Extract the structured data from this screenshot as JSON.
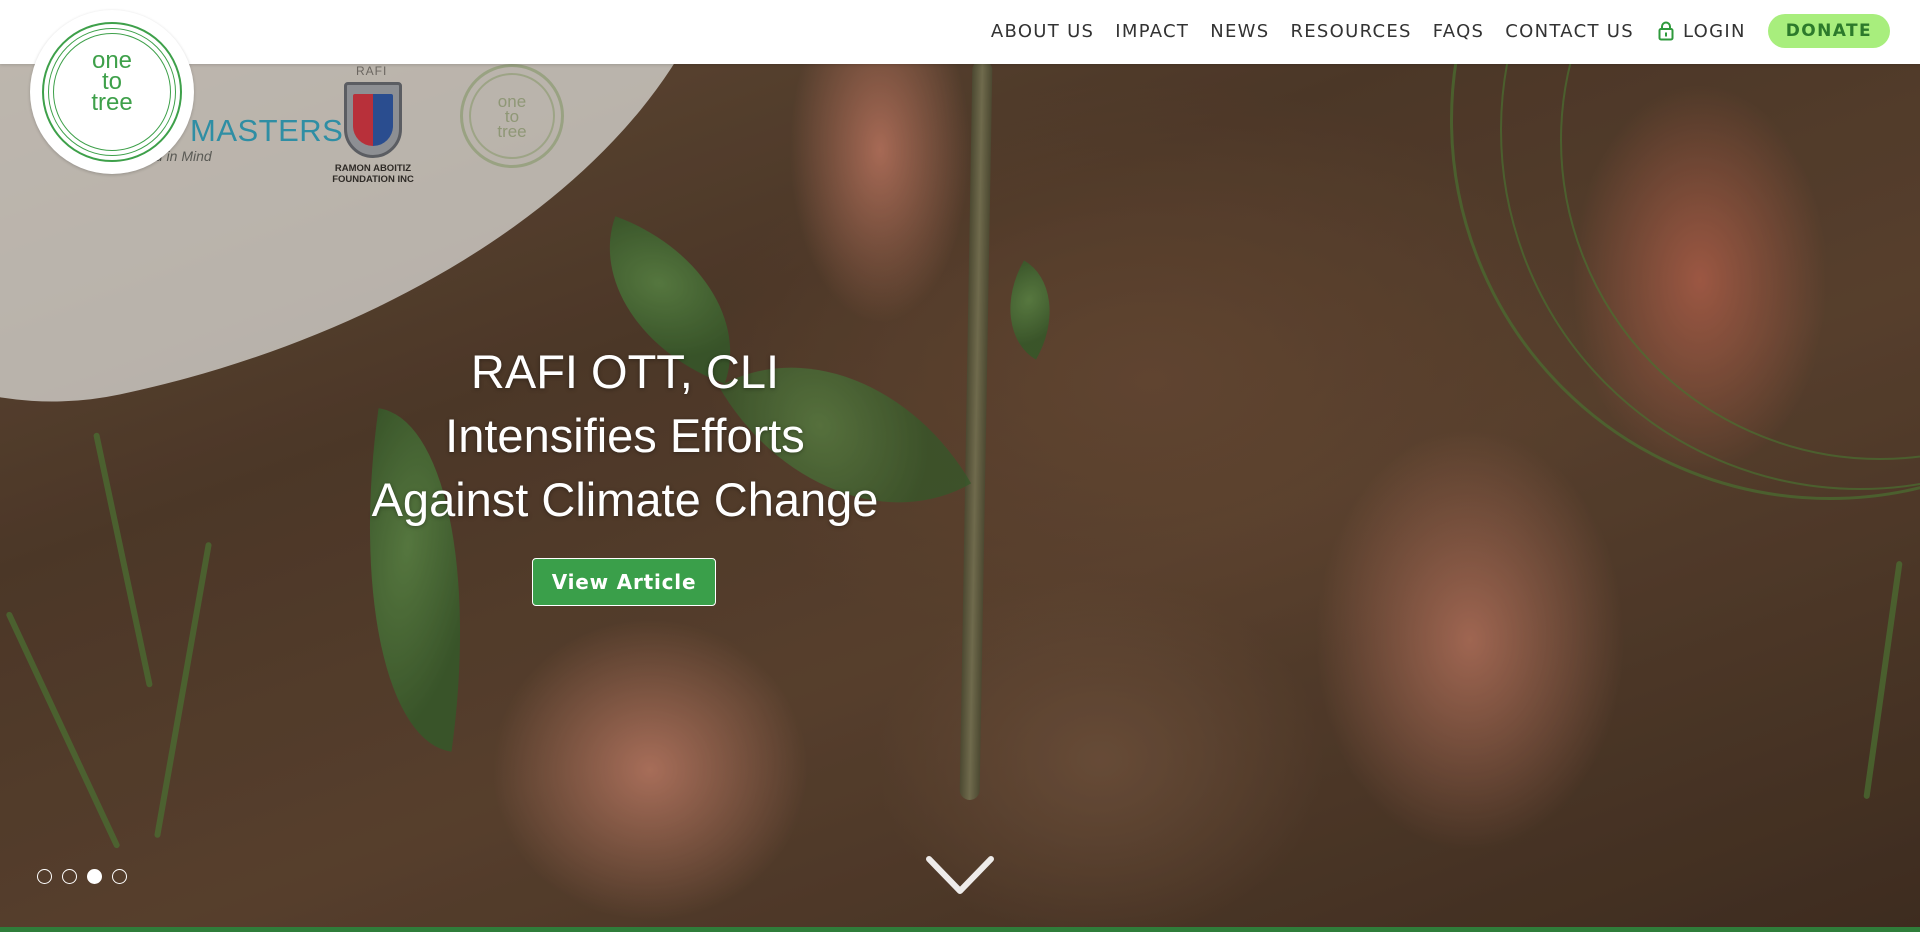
{
  "brand": {
    "logo_text_lines": [
      "one",
      "to",
      "tree"
    ],
    "accent_color": "#3ea04a",
    "donate_bg": "#a8ee7d"
  },
  "nav": {
    "items": [
      {
        "label": "ABOUT US"
      },
      {
        "label": "IMPACT"
      },
      {
        "label": "NEWS"
      },
      {
        "label": "RESOURCES"
      },
      {
        "label": "FAQS"
      },
      {
        "label": "CONTACT US"
      }
    ],
    "login_label": "LOGIN",
    "login_icon": "lock-icon",
    "donate_label": "DONATE"
  },
  "partners": {
    "cleanmasters_text": "MASTERS",
    "cleanmasters_tagline": "with You in Mind",
    "rafi_top": "RAFI",
    "rafi_caption_1": "RAMON ABOITIZ",
    "rafi_caption_2": "FOUNDATION INC",
    "ott_small_lines": [
      "one",
      "to",
      "tree"
    ]
  },
  "hero": {
    "headline_lines": [
      "RAFI OTT, CLI",
      "Intensifies Efforts",
      "Against Climate Change"
    ],
    "cta_label": "View Article",
    "slides_count": 4,
    "active_slide": 3,
    "scroll_icon": "chevron-down-icon"
  }
}
